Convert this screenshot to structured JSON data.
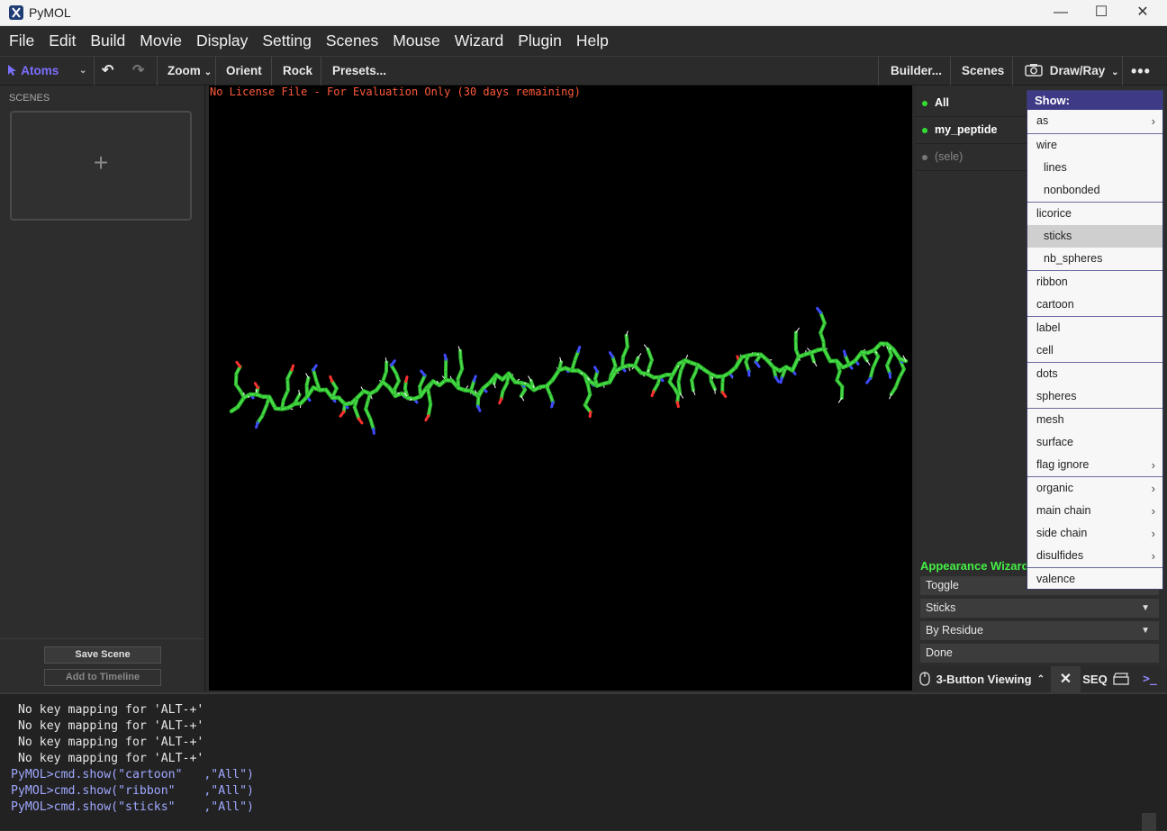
{
  "window": {
    "title": "PyMOL",
    "controls": [
      "—",
      "☐",
      "✕"
    ]
  },
  "menubar": {
    "items": [
      "File",
      "Edit",
      "Build",
      "Movie",
      "Display",
      "Setting",
      "Scenes",
      "Mouse",
      "Wizard",
      "Plugin",
      "Help"
    ]
  },
  "toolbar": {
    "atoms": "Atoms",
    "zoom": "Zoom",
    "orient": "Orient",
    "rock": "Rock",
    "presets": "Presets...",
    "builder": "Builder...",
    "scenes": "Scenes",
    "draw_ray": "Draw/Ray",
    "accent": "#7b70ff"
  },
  "scenes_panel": {
    "label": "SCENES",
    "add_symbol": "+",
    "save_scene": "Save Scene",
    "add_to_timeline": "Add to Timeline"
  },
  "viewport": {
    "license": "No License File - For Evaluation Only (30 days remaining)",
    "background": "#000000"
  },
  "objects": [
    {
      "name": "All",
      "dot_color": "#33dd33",
      "text_color": "#ffffff"
    },
    {
      "name": "my_peptide",
      "dot_color": "#33dd33",
      "text_color": "#ffffff"
    },
    {
      "name": "(sele)",
      "dot_color": "#777777",
      "text_color": "#888888"
    }
  ],
  "show_menu": {
    "header": "Show:",
    "items": {
      "as": "as",
      "wire": "wire",
      "lines": "lines",
      "nonbonded": "nonbonded",
      "licorice": "licorice",
      "sticks": "sticks",
      "nb_spheres": "nb_spheres",
      "ribbon": "ribbon",
      "cartoon": "cartoon",
      "label": "label",
      "cell": "cell",
      "dots": "dots",
      "spheres": "spheres",
      "mesh": "mesh",
      "surface": "surface",
      "flag_ignore": "flag ignore",
      "organic": "organic",
      "main_chain": "main chain",
      "side_chain": "side chain",
      "disulfides": "disulfides",
      "valence": "valence"
    }
  },
  "wizard": {
    "title": "Appearance Wizard",
    "toggle": "Toggle",
    "representation": "Sticks",
    "color_mode": "By Residue",
    "done": "Done"
  },
  "controls": {
    "mouse_mode": "3-Button Viewing",
    "seq": "SEQ",
    "close": "✕",
    "prompt_icon": ">_"
  },
  "console": {
    "lines": [
      {
        "text": " No key mapping for 'ALT-+'",
        "color": "#e8e8e8"
      },
      {
        "text": " No key mapping for 'ALT-+'",
        "color": "#e8e8e8"
      },
      {
        "text": " No key mapping for 'ALT-+'",
        "color": "#e8e8e8"
      },
      {
        "text": " No key mapping for 'ALT-+'",
        "color": "#e8e8e8"
      },
      {
        "text": "PyMOL>cmd.show(\"cartoon\"   ,\"All\")",
        "color": "#9fa8ff"
      },
      {
        "text": "PyMOL>cmd.show(\"ribbon\"    ,\"All\")",
        "color": "#9fa8ff"
      },
      {
        "text": "PyMOL>cmd.show(\"sticks\"    ,\"All\")",
        "color": "#9fa8ff"
      }
    ]
  }
}
